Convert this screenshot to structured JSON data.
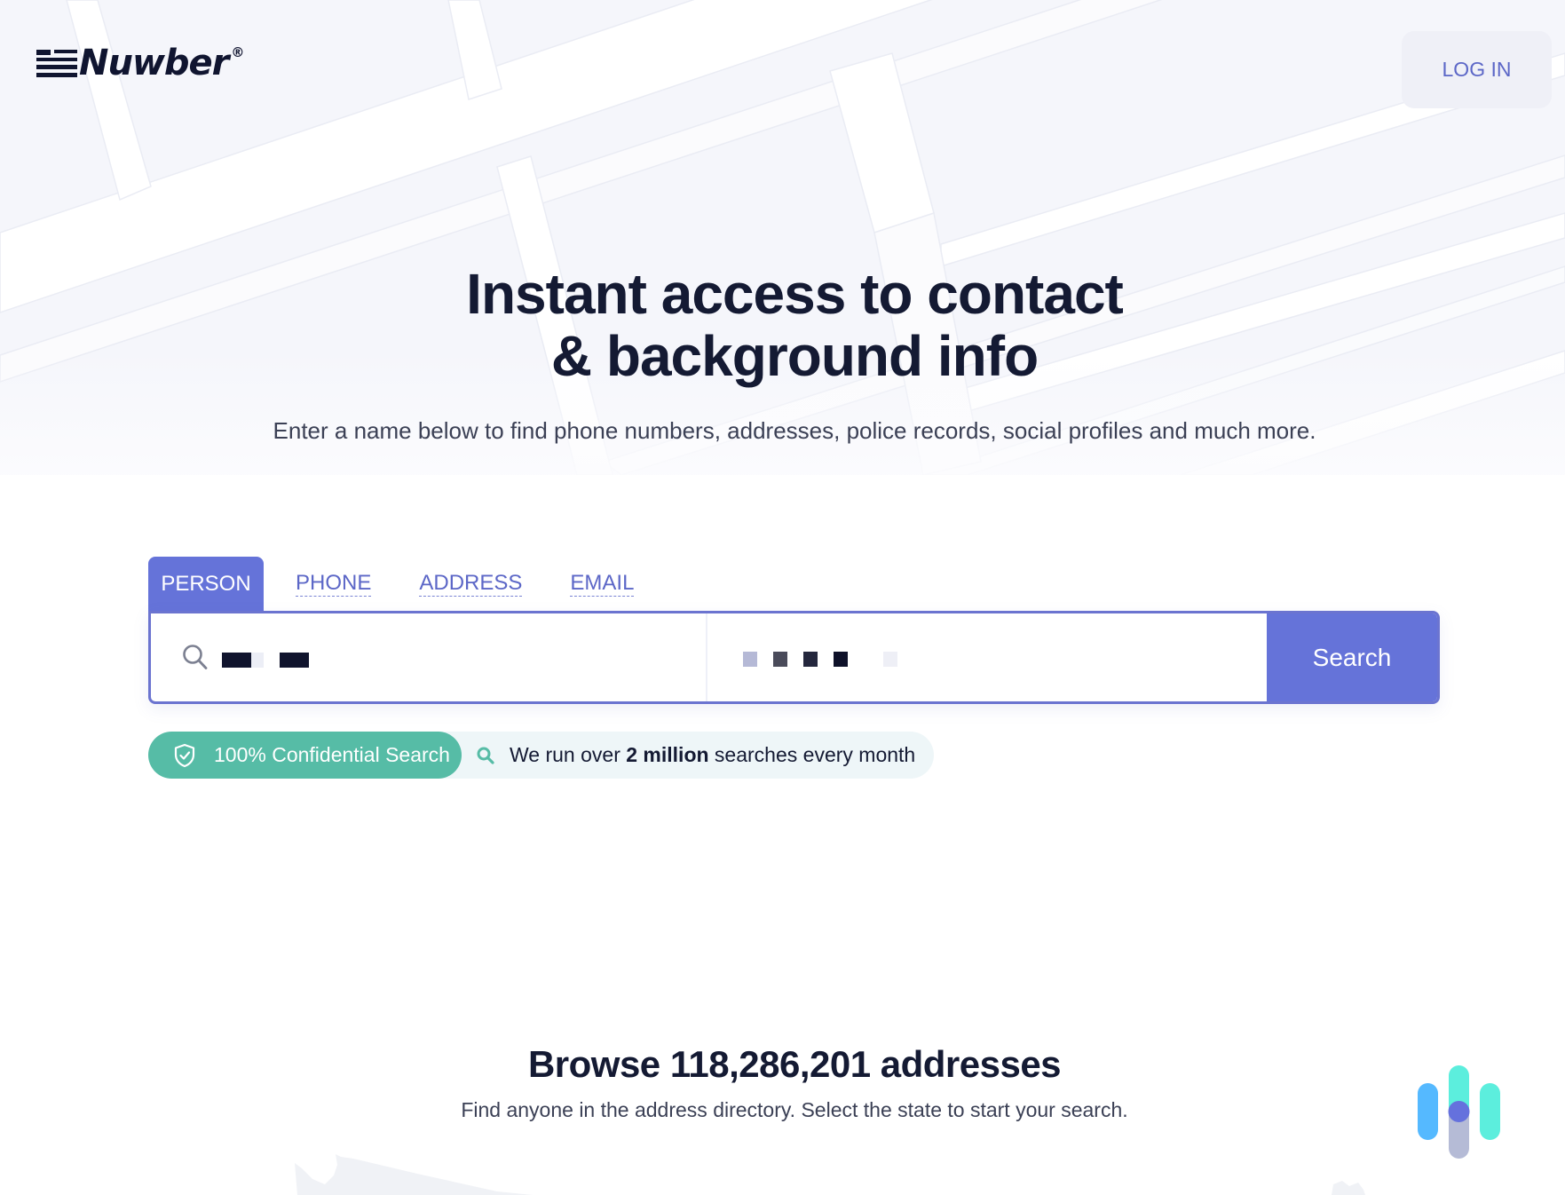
{
  "header": {
    "logo_text": "Nuwber",
    "logo_registered": "®",
    "login_label": "LOG IN"
  },
  "hero": {
    "title_line1": "Instant access to contact",
    "title_line2": "& background info",
    "subtitle": "Enter a name below to find phone numbers, addresses, police records, social profiles and much more."
  },
  "search": {
    "tabs": [
      {
        "label": "PERSON",
        "active": true
      },
      {
        "label": "PHONE",
        "active": false
      },
      {
        "label": "ADDRESS",
        "active": false
      },
      {
        "label": "EMAIL",
        "active": false
      }
    ],
    "name_field": {
      "value": "[redacted]",
      "icon": "search-icon"
    },
    "location_field": {
      "value": "[redacted]"
    },
    "button_label": "Search"
  },
  "badges": {
    "confidential": {
      "icon": "shield-check-icon",
      "label": "100% Confidential Search"
    },
    "stats": {
      "icon": "search-icon",
      "prefix": "We run over ",
      "highlight": "2 million",
      "suffix": " searches every month"
    }
  },
  "browse": {
    "title": "Browse 118,286,201 addresses",
    "subtitle": "Find anyone in the address directory. Select the state to start your search."
  },
  "colors": {
    "accent": "#6573d9",
    "accent_text": "#5c67c7",
    "confidential_green": "#56bca6",
    "heading": "#141a33",
    "body_text": "#3b4055",
    "hero_bg": "#f5f6fb",
    "widget_blue": "#55b9ff",
    "widget_cyan": "#5ceedd",
    "widget_gray": "#b5bbd6"
  }
}
